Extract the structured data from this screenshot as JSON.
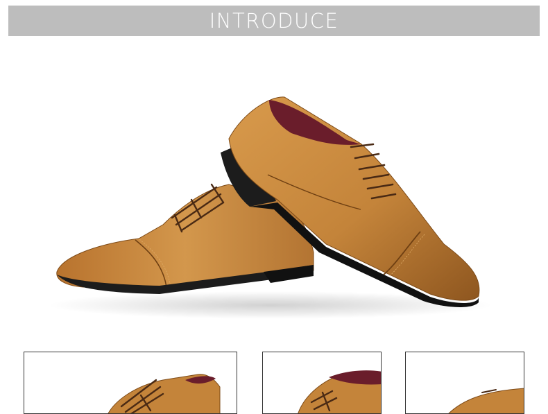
{
  "banner": {
    "title": "INTRODUCE"
  },
  "colors": {
    "banner_bg": "#bdbdbd",
    "leather": "#c98a3e",
    "leather_dark": "#9a5f23",
    "sole": "#1c1c1c",
    "lining": "#6a1d2b"
  },
  "images": {
    "hero": "product-photo-pair-of-brown-oxford-shoes",
    "thumbnails": [
      "shoe-side-view",
      "shoe-top-detail",
      "shoe-toe-detail"
    ]
  }
}
